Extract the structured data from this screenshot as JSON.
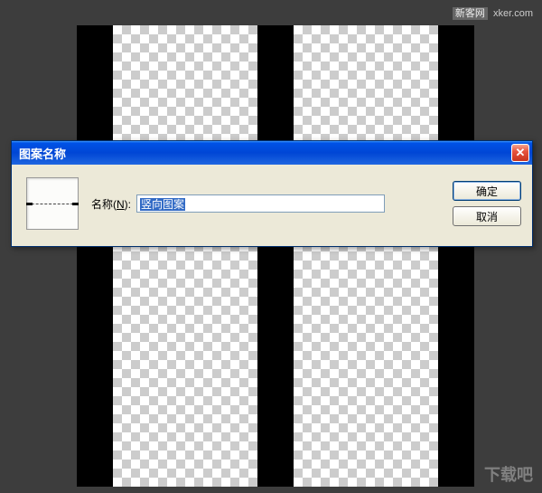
{
  "watermark": {
    "top_tag": "新客网",
    "top_url": "xker.com",
    "bottom": "下载吧"
  },
  "dialog": {
    "title": "图案名称",
    "name_label_prefix": "名称(",
    "name_label_key": "N",
    "name_label_suffix": "):",
    "input_value": "竖向图案",
    "ok_label": "确定",
    "cancel_label": "取消",
    "close_symbol": "✕"
  }
}
